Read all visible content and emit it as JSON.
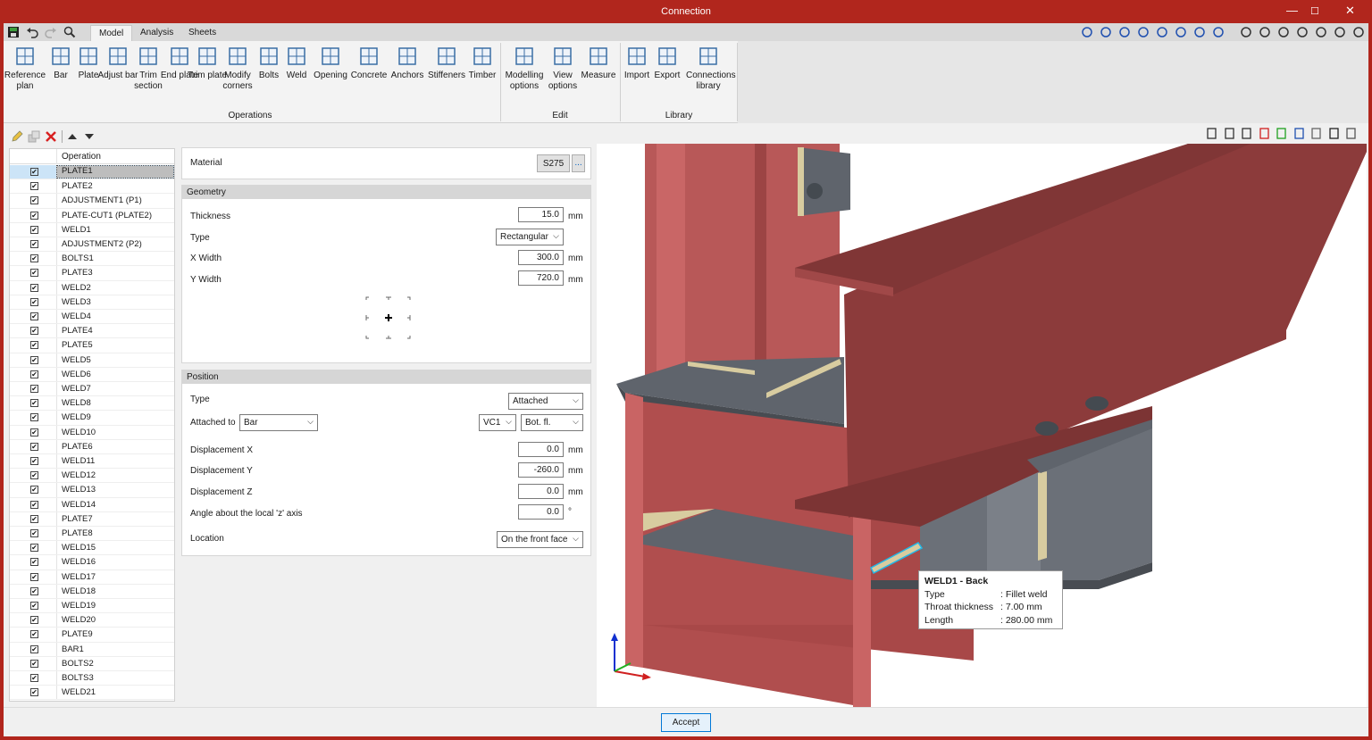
{
  "window": {
    "title": "Connection",
    "minimize": "—",
    "maximize": "☐",
    "close": "✕"
  },
  "tabs": [
    {
      "label": "Model",
      "active": true
    },
    {
      "label": "Analysis",
      "active": false
    },
    {
      "label": "Sheets",
      "active": false
    }
  ],
  "quick_access": [
    "save-icon",
    "undo-icon",
    "redo-icon",
    "search-icon"
  ],
  "ribbon": {
    "buttons": [
      {
        "label": "Reference plan",
        "icon": "grid-icon"
      },
      {
        "label": "Bar",
        "icon": "ibeam-icon"
      },
      {
        "label": "Plate",
        "icon": "plate-icon"
      },
      {
        "label": "Adjust bar",
        "icon": "adjust-bar-icon"
      },
      {
        "label": "Trim section",
        "icon": "trim-section-icon"
      },
      {
        "label": "End plate",
        "icon": "end-plate-icon"
      },
      {
        "label": "Trim plate",
        "icon": "trim-plate-icon"
      },
      {
        "label": "Modify corners",
        "icon": "modify-corners-icon"
      },
      {
        "label": "Bolts",
        "icon": "bolt-icon"
      },
      {
        "label": "Weld",
        "icon": "weld-icon"
      },
      {
        "label": "Opening",
        "icon": "opening-icon"
      },
      {
        "label": "Concrete",
        "icon": "concrete-icon"
      },
      {
        "label": "Anchors",
        "icon": "anchor-icon"
      },
      {
        "label": "Stiffeners",
        "icon": "stiffener-icon"
      },
      {
        "label": "Timber",
        "icon": "timber-screw-icon"
      },
      {
        "label": "Modelling options",
        "icon": "modelling-options-icon"
      },
      {
        "label": "View options",
        "icon": "view-options-icon"
      },
      {
        "label": "Measure",
        "icon": "measure-icon"
      },
      {
        "label": "Import",
        "icon": "import-icon"
      },
      {
        "label": "Export",
        "icon": "export-icon"
      },
      {
        "label": "Connections library",
        "icon": "library-icon"
      }
    ],
    "groups": [
      {
        "label": "Operations"
      },
      {
        "label": "Edit"
      },
      {
        "label": "Library"
      }
    ]
  },
  "view_toolbar": [
    "rotate-icon",
    "zoom-all-icon",
    "zoom-window-icon",
    "refresh-icon",
    "zoom-icon",
    "pan-hand-icon",
    "orbit-icon",
    "view-fit-icon",
    "frame-icon",
    "dimension-icon",
    "axes-icon",
    "clock-icon",
    "layers-icon",
    "comment-icon",
    "tools-icon"
  ],
  "list_toolbar": [
    "edit-pencil-icon",
    "copy-icon",
    "delete-icon",
    "move-up-icon",
    "move-down-icon"
  ],
  "operations": {
    "header": "Operation",
    "items": [
      "PLATE1",
      "PLATE2",
      "ADJUSTMENT1 (P1)",
      "PLATE-CUT1 (PLATE2)",
      "WELD1",
      "ADJUSTMENT2 (P2)",
      "BOLTS1",
      "PLATE3",
      "WELD2",
      "WELD3",
      "WELD4",
      "PLATE4",
      "PLATE5",
      "WELD5",
      "WELD6",
      "WELD7",
      "WELD8",
      "WELD9",
      "WELD10",
      "PLATE6",
      "WELD11",
      "WELD12",
      "WELD13",
      "WELD14",
      "PLATE7",
      "PLATE8",
      "WELD15",
      "WELD16",
      "WELD17",
      "WELD18",
      "WELD19",
      "WELD20",
      "PLATE9",
      "BAR1",
      "BOLTS2",
      "BOLTS3",
      "WELD21"
    ],
    "selected": "PLATE1"
  },
  "material": {
    "label": "Material",
    "value": "S275",
    "more": "..."
  },
  "geometry": {
    "header": "Geometry",
    "thickness": {
      "label": "Thickness",
      "value": "15.0",
      "unit": "mm"
    },
    "type": {
      "label": "Type",
      "value": "Rectangular"
    },
    "x_width": {
      "label": "X Width",
      "value": "300.0",
      "unit": "mm"
    },
    "y_width": {
      "label": "Y Width",
      "value": "720.0",
      "unit": "mm"
    }
  },
  "position": {
    "header": "Position",
    "type": {
      "label": "Type",
      "value": "Attached"
    },
    "attached_to": {
      "label": "Attached to",
      "value": "Bar",
      "member": "VC1",
      "face": "Bot. fl."
    },
    "disp_x": {
      "label": "Displacement X",
      "value": "0.0",
      "unit": "mm"
    },
    "disp_y": {
      "label": "Displacement Y",
      "value": "-260.0",
      "unit": "mm"
    },
    "disp_z": {
      "label": "Displacement Z",
      "value": "0.0",
      "unit": "mm"
    },
    "angle": {
      "label": "Angle about the local 'z' axis",
      "value": "0.0",
      "unit": "°"
    },
    "location": {
      "label": "Location",
      "value": "On the front face"
    }
  },
  "viewport_toolbar": [
    "axes-icon",
    "render-icon",
    "section-icon",
    "red-plane-icon",
    "green-plane-icon",
    "blue-plane-icon",
    "cube-icon",
    "visibility-icon",
    "3d-view-icon"
  ],
  "tooltip": {
    "title": "WELD1 - Back",
    "rows": [
      {
        "k": "Type",
        "v": ": Fillet weld"
      },
      {
        "k": "Throat thickness",
        "v": ": 7.00 mm"
      },
      {
        "k": "Length",
        "v": ": 280.00 mm"
      }
    ]
  },
  "accept": "Accept",
  "colors": {
    "titlebar": "#b1261d",
    "steel": "#b85656",
    "plate": "#5f646c",
    "weld": "#d8ccA0",
    "highlight": "#22b8e8",
    "accent": "#0078d7"
  }
}
